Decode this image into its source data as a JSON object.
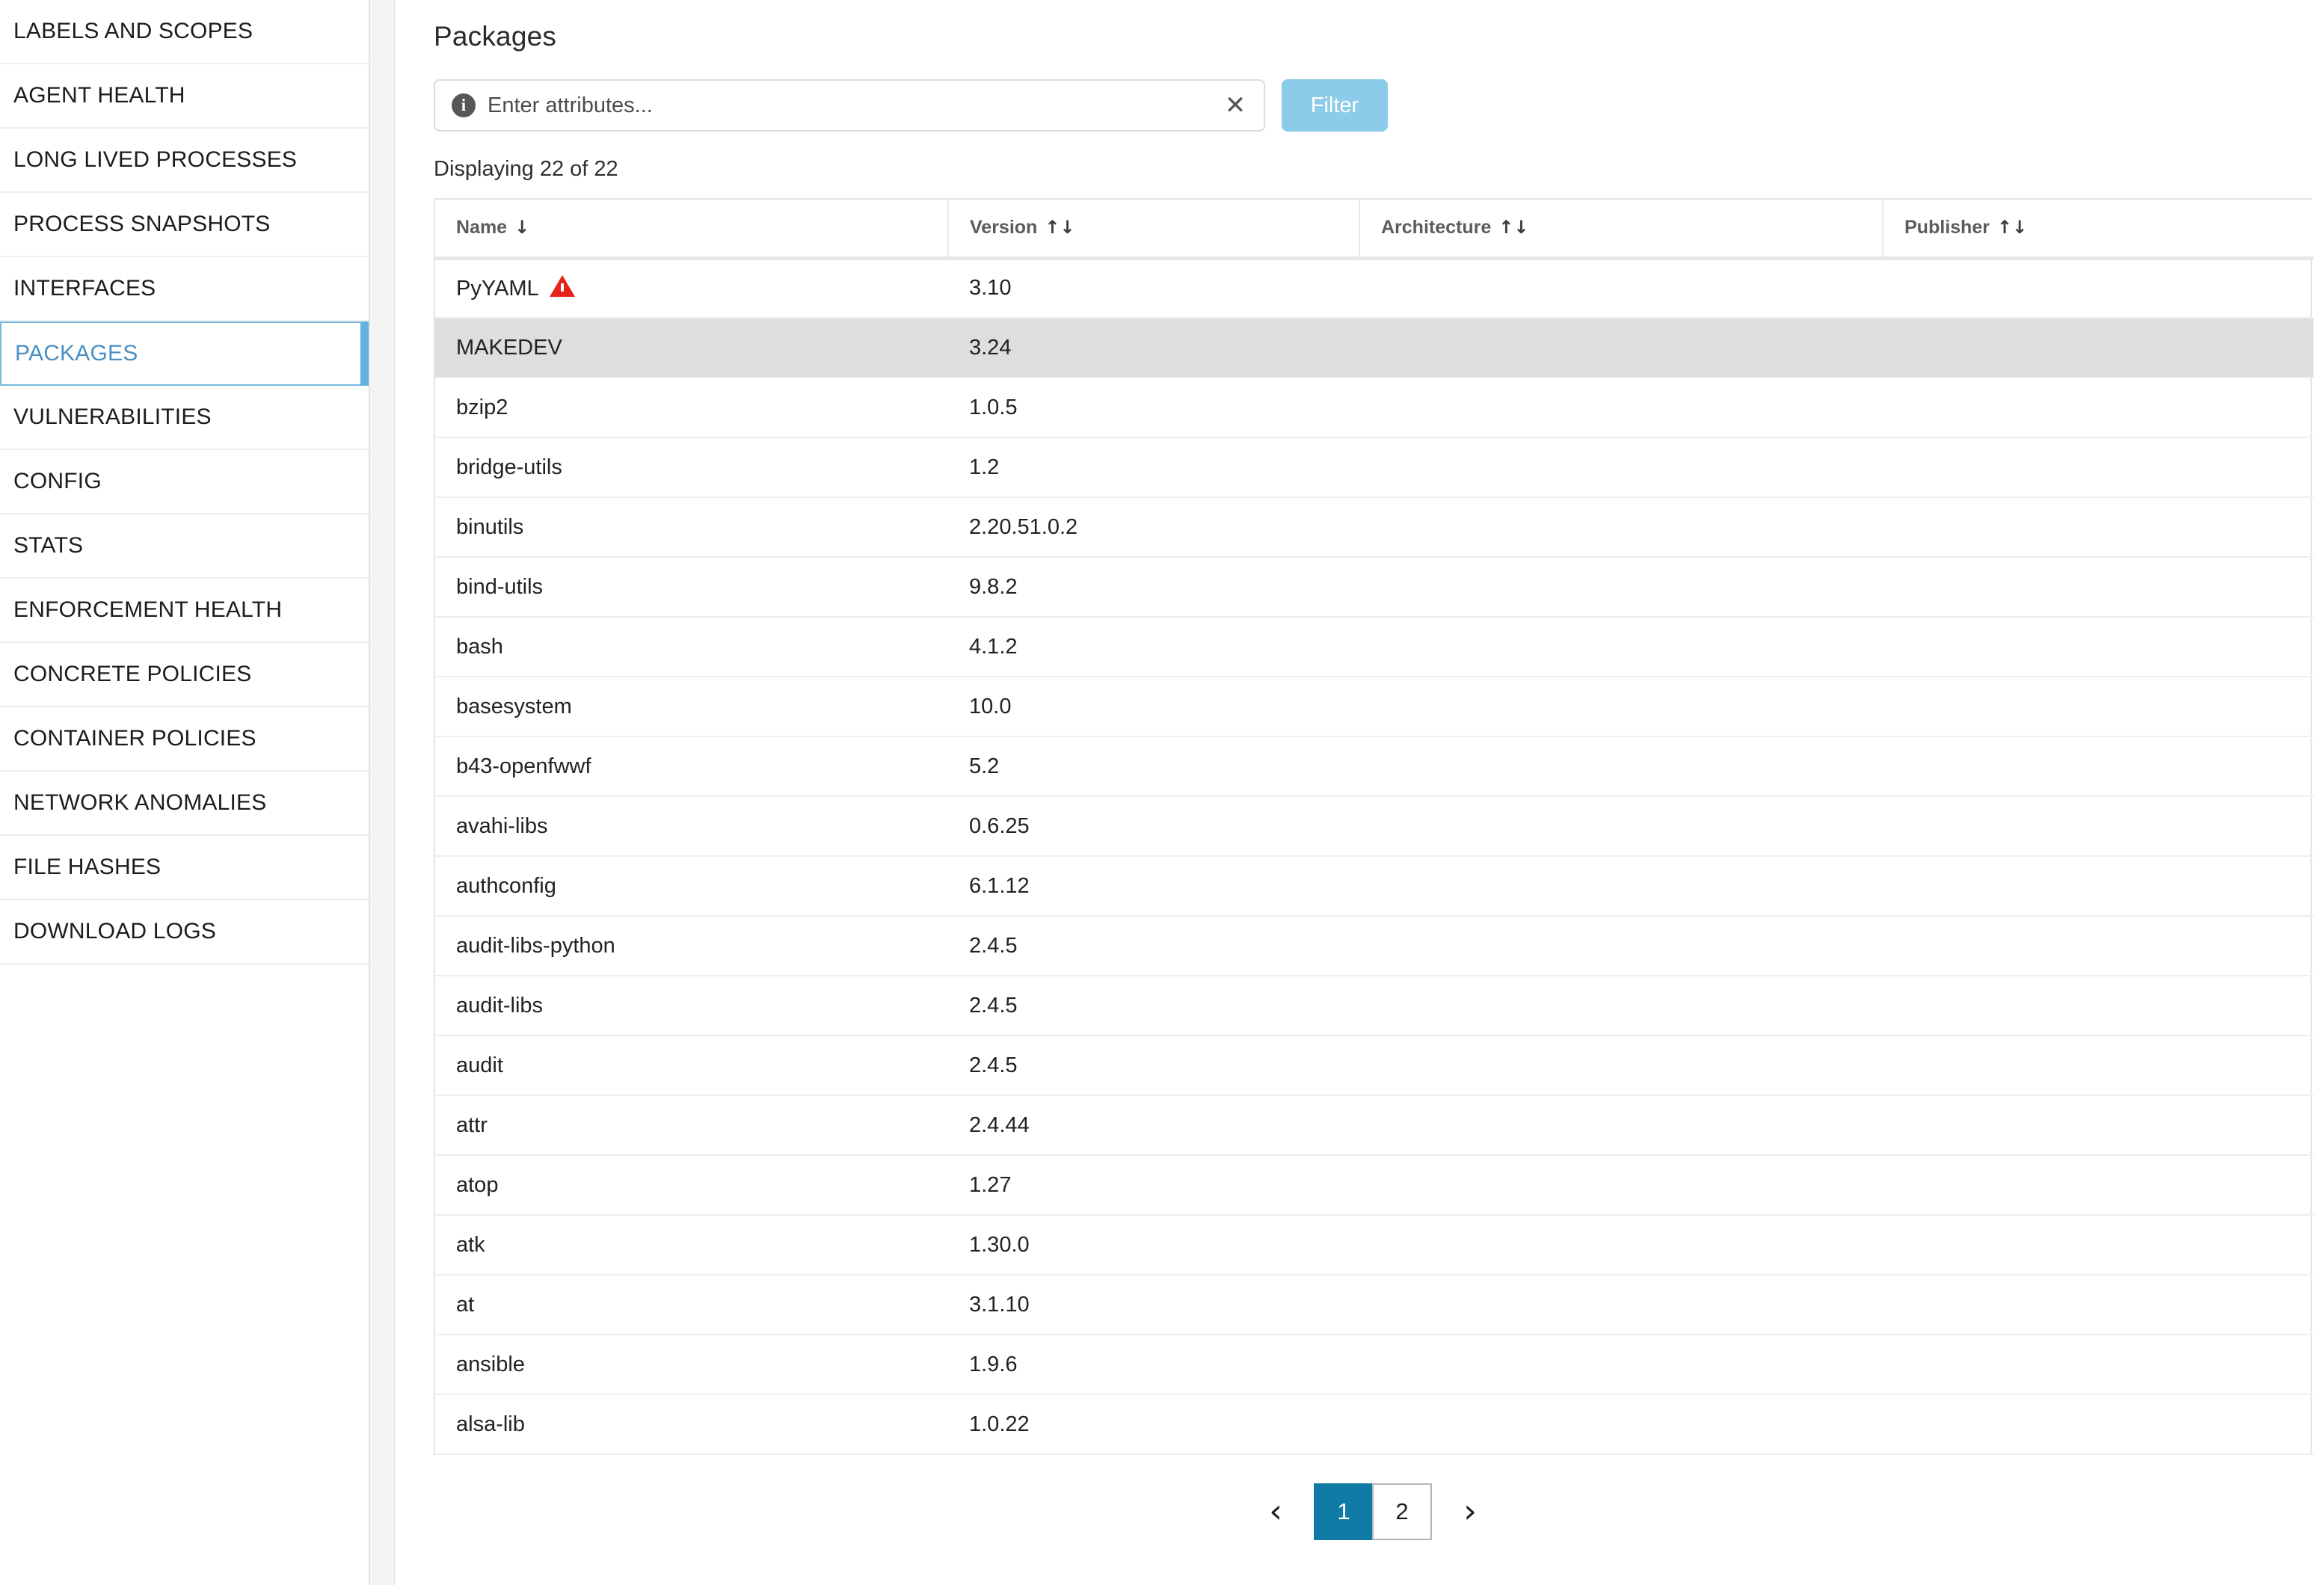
{
  "sidebar": {
    "items": [
      {
        "label": "LABELS AND SCOPES",
        "active": false
      },
      {
        "label": "AGENT HEALTH",
        "active": false
      },
      {
        "label": "LONG LIVED PROCESSES",
        "active": false
      },
      {
        "label": "PROCESS SNAPSHOTS",
        "active": false
      },
      {
        "label": "INTERFACES",
        "active": false
      },
      {
        "label": "PACKAGES",
        "active": true
      },
      {
        "label": "VULNERABILITIES",
        "active": false
      },
      {
        "label": "CONFIG",
        "active": false
      },
      {
        "label": "STATS",
        "active": false
      },
      {
        "label": "ENFORCEMENT HEALTH",
        "active": false
      },
      {
        "label": "CONCRETE POLICIES",
        "active": false
      },
      {
        "label": "CONTAINER POLICIES",
        "active": false
      },
      {
        "label": "NETWORK ANOMALIES",
        "active": false
      },
      {
        "label": "FILE HASHES",
        "active": false
      },
      {
        "label": "DOWNLOAD LOGS",
        "active": false
      }
    ]
  },
  "main": {
    "title": "Packages",
    "filter": {
      "info_icon": "info-icon",
      "placeholder": "Enter attributes...",
      "value": "",
      "clear_icon": "close-icon",
      "button_label": "Filter",
      "button_color": "#8ccbea",
      "button_enabled": false
    },
    "displaying": "Displaying 22 of 22",
    "table": {
      "columns": [
        {
          "label": "Name",
          "sort": "desc",
          "sort_glyph": "↓"
        },
        {
          "label": "Version",
          "sort": "none",
          "sort_glyph": "↑↓"
        },
        {
          "label": "Architecture",
          "sort": "none",
          "sort_glyph": "↑↓"
        },
        {
          "label": "Publisher",
          "sort": "none",
          "sort_glyph": "↑↓"
        }
      ],
      "rows": [
        {
          "name": "PyYAML",
          "version": "3.10",
          "architecture": "",
          "publisher": "",
          "warning": true,
          "hovered": false
        },
        {
          "name": "MAKEDEV",
          "version": "3.24",
          "architecture": "",
          "publisher": "",
          "warning": false,
          "hovered": true
        },
        {
          "name": "bzip2",
          "version": "1.0.5",
          "architecture": "",
          "publisher": "",
          "warning": false,
          "hovered": false
        },
        {
          "name": "bridge-utils",
          "version": "1.2",
          "architecture": "",
          "publisher": "",
          "warning": false,
          "hovered": false
        },
        {
          "name": "binutils",
          "version": "2.20.51.0.2",
          "architecture": "",
          "publisher": "",
          "warning": false,
          "hovered": false
        },
        {
          "name": "bind-utils",
          "version": "9.8.2",
          "architecture": "",
          "publisher": "",
          "warning": false,
          "hovered": false
        },
        {
          "name": "bash",
          "version": "4.1.2",
          "architecture": "",
          "publisher": "",
          "warning": false,
          "hovered": false
        },
        {
          "name": "basesystem",
          "version": "10.0",
          "architecture": "",
          "publisher": "",
          "warning": false,
          "hovered": false
        },
        {
          "name": "b43-openfwwf",
          "version": "5.2",
          "architecture": "",
          "publisher": "",
          "warning": false,
          "hovered": false
        },
        {
          "name": "avahi-libs",
          "version": "0.6.25",
          "architecture": "",
          "publisher": "",
          "warning": false,
          "hovered": false
        },
        {
          "name": "authconfig",
          "version": "6.1.12",
          "architecture": "",
          "publisher": "",
          "warning": false,
          "hovered": false
        },
        {
          "name": "audit-libs-python",
          "version": "2.4.5",
          "architecture": "",
          "publisher": "",
          "warning": false,
          "hovered": false
        },
        {
          "name": "audit-libs",
          "version": "2.4.5",
          "architecture": "",
          "publisher": "",
          "warning": false,
          "hovered": false
        },
        {
          "name": "audit",
          "version": "2.4.5",
          "architecture": "",
          "publisher": "",
          "warning": false,
          "hovered": false
        },
        {
          "name": "attr",
          "version": "2.4.44",
          "architecture": "",
          "publisher": "",
          "warning": false,
          "hovered": false
        },
        {
          "name": "atop",
          "version": "1.27",
          "architecture": "",
          "publisher": "",
          "warning": false,
          "hovered": false
        },
        {
          "name": "atk",
          "version": "1.30.0",
          "architecture": "",
          "publisher": "",
          "warning": false,
          "hovered": false
        },
        {
          "name": "at",
          "version": "3.1.10",
          "architecture": "",
          "publisher": "",
          "warning": false,
          "hovered": false
        },
        {
          "name": "ansible",
          "version": "1.9.6",
          "architecture": "",
          "publisher": "",
          "warning": false,
          "hovered": false
        },
        {
          "name": "alsa-lib",
          "version": "1.0.22",
          "architecture": "",
          "publisher": "",
          "warning": false,
          "hovered": false
        }
      ]
    },
    "pagination": {
      "prev_icon": "chevron-left-icon",
      "next_icon": "chevron-right-icon",
      "pages": [
        {
          "label": "1",
          "active": true
        },
        {
          "label": "2",
          "active": false
        }
      ]
    }
  },
  "colors": {
    "accent_blue": "#0f7ba5",
    "active_nav_blue": "#4a90c4",
    "filter_button": "#8ccbea",
    "warning_red": "#e5231b",
    "row_hover": "#dedede"
  }
}
